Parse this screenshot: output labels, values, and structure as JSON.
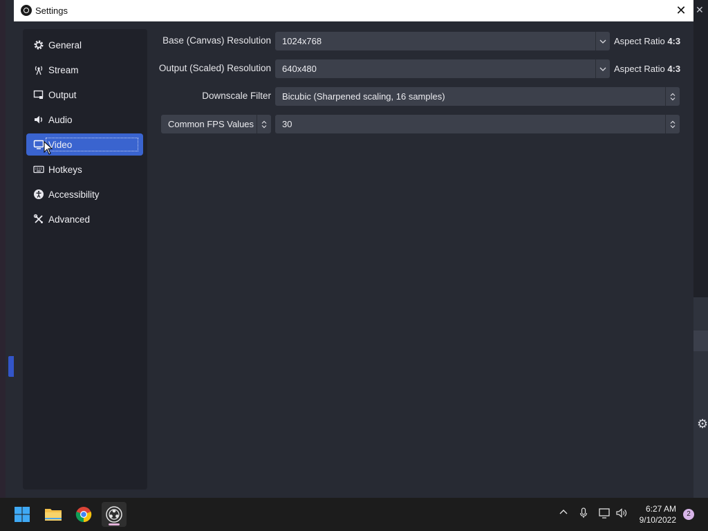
{
  "window": {
    "title": "Settings"
  },
  "sidebar": {
    "items": [
      {
        "label": "General",
        "icon": "gear-icon"
      },
      {
        "label": "Stream",
        "icon": "antenna-icon"
      },
      {
        "label": "Output",
        "icon": "output-icon"
      },
      {
        "label": "Audio",
        "icon": "speaker-icon"
      },
      {
        "label": "Video",
        "icon": "monitor-icon",
        "active": true
      },
      {
        "label": "Hotkeys",
        "icon": "keyboard-icon"
      },
      {
        "label": "Accessibility",
        "icon": "accessibility-icon"
      },
      {
        "label": "Advanced",
        "icon": "tools-icon"
      }
    ]
  },
  "video": {
    "base_label": "Base (Canvas) Resolution",
    "base_value": "1024x768",
    "base_aspect_prefix": "Aspect Ratio",
    "base_aspect_value": "4:3",
    "output_label": "Output (Scaled) Resolution",
    "output_value": "640x480",
    "output_aspect_prefix": "Aspect Ratio",
    "output_aspect_value": "4:3",
    "downscale_label": "Downscale Filter",
    "downscale_value": "Bicubic (Sharpened scaling, 16 samples)",
    "fps_type": "Common FPS Values",
    "fps_value": "30"
  },
  "taskbar": {
    "time": "6:27 AM",
    "date": "9/10/2022",
    "notification_count": "2"
  },
  "colors": {
    "accent": "#3a64cf",
    "panel": "#272a33",
    "sidebar": "#1f2129",
    "input": "#3c404b"
  }
}
